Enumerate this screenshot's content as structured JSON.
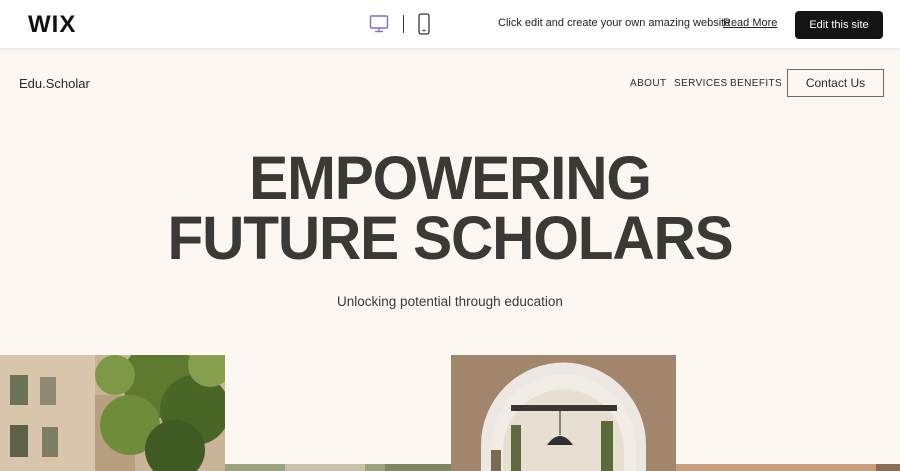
{
  "wix_bar": {
    "logo": "WIX",
    "message": "Click edit and create your own amazing website",
    "read_more": "Read More",
    "edit_button": "Edit this site",
    "icons": [
      "desktop-icon",
      "mobile-icon"
    ]
  },
  "site": {
    "logo": "Edu.Scholar",
    "nav": [
      "ABOUT",
      "SERVICES",
      "BENEFITS"
    ],
    "contact_button": "Contact Us"
  },
  "hero": {
    "title_line1": "EMPOWERING",
    "title_line2": "FUTURE SCHOLARS",
    "subtitle": "Unlocking potential through education"
  },
  "colors": {
    "background": "#fcf7f1",
    "text": "#3a3936",
    "accent_desktop_icon": "#8a7bd6",
    "button_dark": "#141414"
  }
}
